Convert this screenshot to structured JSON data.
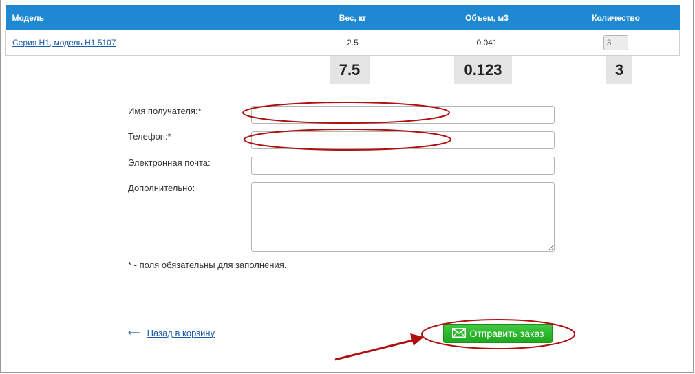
{
  "table": {
    "headers": {
      "model": "Модель",
      "weight": "Вес, кг",
      "volume": "Объем, м3",
      "quantity": "Количество"
    },
    "rows": [
      {
        "model": "Серия H1, модель H1 5107",
        "weight": "2.5",
        "volume": "0.041",
        "quantity": "3"
      }
    ],
    "totals": {
      "weight": "7.5",
      "volume": "0.123",
      "quantity": "3"
    }
  },
  "form": {
    "recipient_label": "Имя получателя:*",
    "phone_label": "Телефон:*",
    "email_label": "Электронная почта:",
    "extra_label": "Дополнительно:",
    "required_note": "* - поля обязательны для заполнения."
  },
  "actions": {
    "back_arrow": "⟵",
    "back_label": "Назад в корзину",
    "submit_label": "Отправить заказ"
  },
  "colors": {
    "header_bg": "#1e88d2",
    "submit_bg": "#2db82d",
    "annotation_red": "#b01010",
    "link": "#1a5aa8"
  },
  "icons": {
    "submit_icon": "envelope-icon",
    "annotation_arrow": "arrow-annotation"
  }
}
